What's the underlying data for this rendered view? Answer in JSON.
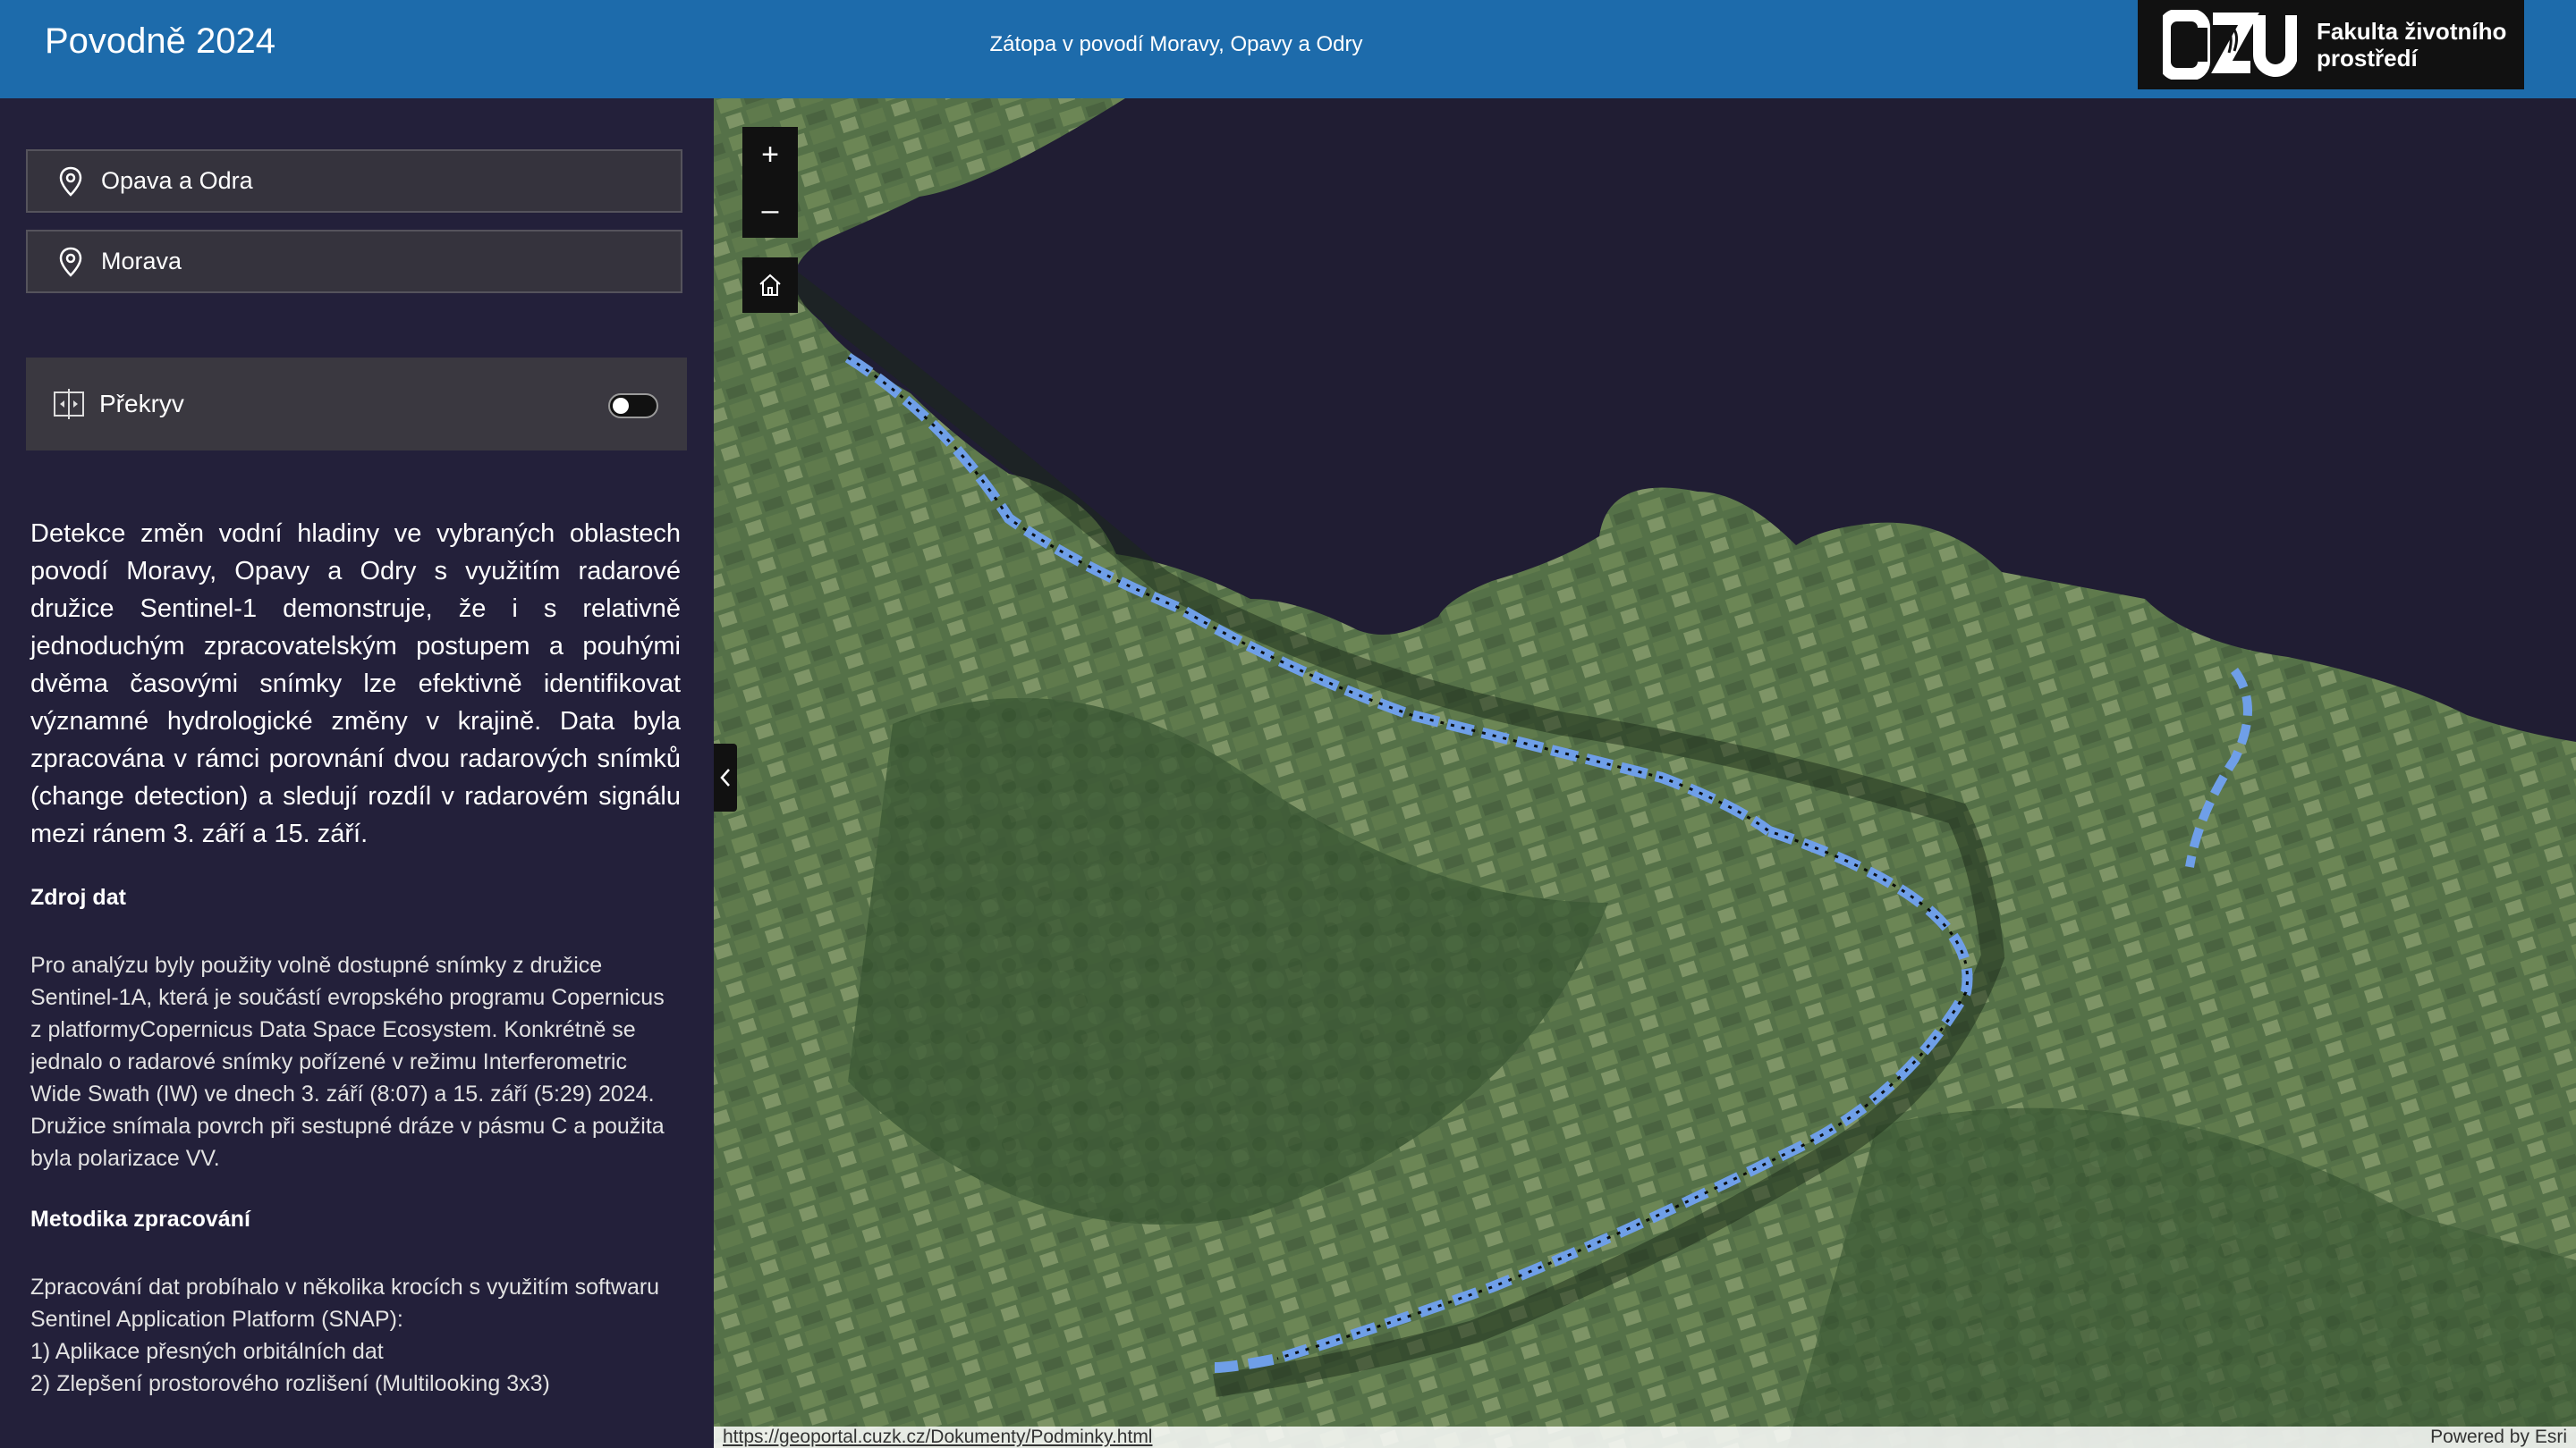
{
  "header": {
    "title": "Povodně 2024",
    "subtitle": "Zátopa v povodí Moravy, Opavy a Odry",
    "logo_text_line1": "Fakulta životního",
    "logo_text_line2": "prostředí"
  },
  "panel": {
    "locations": [
      {
        "label": "Opava a Odra"
      },
      {
        "label": "Morava"
      }
    ],
    "overlay": {
      "label": "Překryv",
      "enabled": false
    },
    "description": "Detekce změn vodní hladiny ve vybraných oblastech povodí Moravy, Opavy a Odry s využitím radarové družice Sentinel-1 demonstruje, že i s relativně jednoduchým zpracovatelským postupem a pouhými dvěma časovými snímky lze efektivně identifikovat významné hydrologické změny v krajině.  Data byla zpracována v rámci porovnání dvou radarových snímků (change detection) a sledují rozdíl v radarovém signálu mezi ránem 3. září a 15. září.",
    "source_title": "Zdroj dat",
    "source_text": "Pro analýzu byly použity volně dostupné snímky z družice Sentinel-1A, která je součástí evropského programu Copernicus z platformyCopernicus Data Space Ecosystem.  Konkrétně se jednalo o radarové snímky pořízené v režimu Interferometric Wide Swath (IW) ve dnech 3. září (8:07) a 15. září (5:29) 2024. Družice snímala povrch při sestupné dráze v pásmu C a použita byla polarizace VV.",
    "method_title": "Metodika zpracování",
    "method_text": "Zpracování dat probíhalo v několika krocích s využitím softwaru Sentinel Application Platform (SNAP):\n1) Aplikace přesných orbitálních dat\n2) Zlepšení prostorového rozlišení (Multilooking 3x3)"
  },
  "map": {
    "zoom_in": "+",
    "zoom_out": "–",
    "attribution_left": "https://geoportal.cuzk.cz/Dokumenty/Podminky.html",
    "attribution_right": "Powered by Esri",
    "colors": {
      "nodata": "#201d33",
      "flood": "#6f9fe8",
      "terrain": "#4f6a48"
    }
  }
}
